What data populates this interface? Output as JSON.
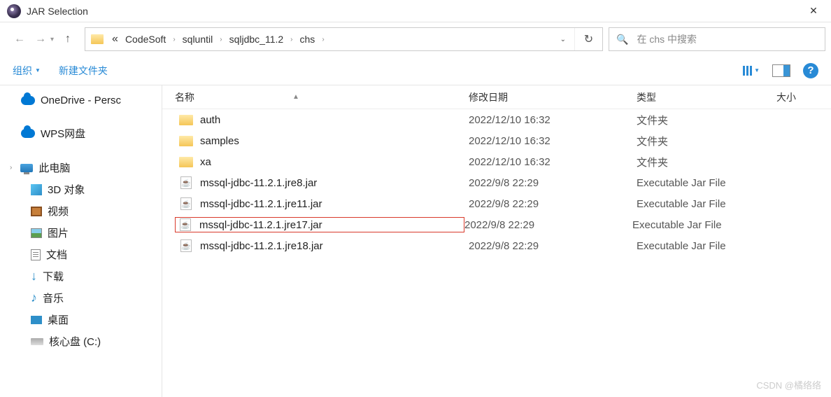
{
  "window": {
    "title": "JAR Selection"
  },
  "breadcrumbs": {
    "prefix": "«",
    "items": [
      "CodeSoft",
      "sqluntil",
      "sqljdbc_11.2",
      "chs"
    ]
  },
  "search": {
    "placeholder": "在 chs 中搜索"
  },
  "toolbar": {
    "organize": "组织",
    "newfolder": "新建文件夹"
  },
  "sidebar": {
    "onedrive": "OneDrive - Persc",
    "wps": "WPS网盘",
    "thispc": "此电脑",
    "objects3d": "3D 对象",
    "videos": "视频",
    "pictures": "图片",
    "documents": "文档",
    "downloads": "下载",
    "music": "音乐",
    "desktop": "桌面",
    "cdrive": "核心盘 (C:)"
  },
  "columns": {
    "name": "名称",
    "date": "修改日期",
    "type": "类型",
    "size": "大小"
  },
  "files": [
    {
      "name": "auth",
      "date": "2022/12/10 16:32",
      "type": "文件夹",
      "kind": "folder"
    },
    {
      "name": "samples",
      "date": "2022/12/10 16:32",
      "type": "文件夹",
      "kind": "folder"
    },
    {
      "name": "xa",
      "date": "2022/12/10 16:32",
      "type": "文件夹",
      "kind": "folder"
    },
    {
      "name": "mssql-jdbc-11.2.1.jre8.jar",
      "date": "2022/9/8 22:29",
      "type": "Executable Jar File",
      "kind": "jar"
    },
    {
      "name": "mssql-jdbc-11.2.1.jre11.jar",
      "date": "2022/9/8 22:29",
      "type": "Executable Jar File",
      "kind": "jar"
    },
    {
      "name": "mssql-jdbc-11.2.1.jre17.jar",
      "date": "2022/9/8 22:29",
      "type": "Executable Jar File",
      "kind": "jar",
      "highlighted": true
    },
    {
      "name": "mssql-jdbc-11.2.1.jre18.jar",
      "date": "2022/9/8 22:29",
      "type": "Executable Jar File",
      "kind": "jar"
    }
  ],
  "watermark": "CSDN @橘络络"
}
